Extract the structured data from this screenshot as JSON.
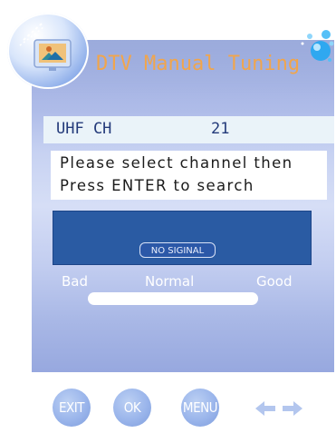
{
  "header": {
    "title": "DTV Manual Tuning"
  },
  "channel": {
    "band_label": "UHF CH",
    "number": "21"
  },
  "message": {
    "line1": "Please select channel then",
    "line2": "Press ENTER to search"
  },
  "signal": {
    "status": "NO SIGINAL",
    "quality_labels": {
      "bad": "Bad",
      "normal": "Normal",
      "good": "Good"
    },
    "quality_level": 0
  },
  "controls": {
    "exit": "EXIT",
    "ok": "OK",
    "menu": "MENU",
    "arrows_icon": "left-right-arrows-icon"
  },
  "colors": {
    "title": "#f1a54c",
    "signal_box": "#2a5ba3",
    "text_dark": "#233a7a"
  }
}
